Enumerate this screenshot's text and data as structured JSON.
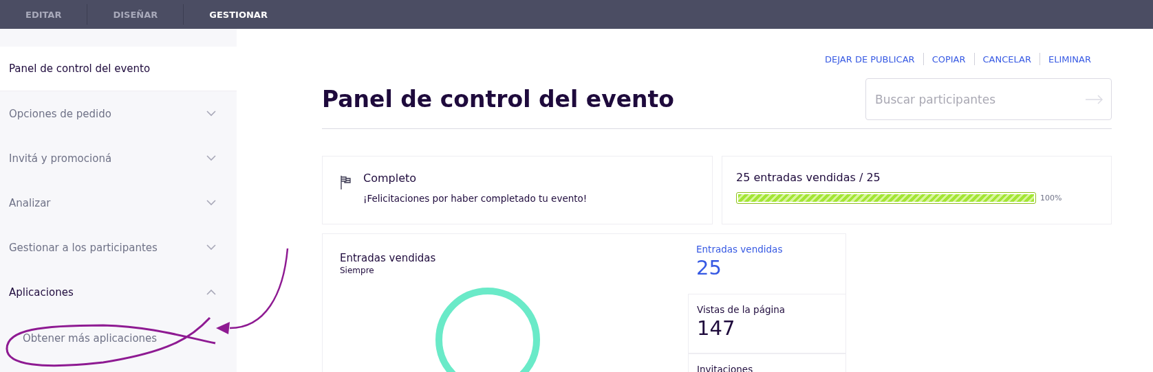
{
  "top_tabs": [
    {
      "label": "EDITAR",
      "selected": false
    },
    {
      "label": "DISEÑAR",
      "selected": false
    },
    {
      "label": "GESTIONAR",
      "selected": true
    }
  ],
  "sidebar": {
    "items": [
      {
        "label": "Panel de control del evento",
        "selected": true
      },
      {
        "label": "Opciones de pedido",
        "selected": false,
        "expanded": false
      },
      {
        "label": "Invitá y promocioná",
        "selected": false,
        "expanded": false
      },
      {
        "label": "Analizar",
        "selected": false,
        "expanded": false
      },
      {
        "label": "Gestionar a los participantes",
        "selected": false,
        "expanded": false
      },
      {
        "label": "Aplicaciones",
        "selected": false,
        "expanded": true,
        "children": [
          {
            "label": "Obtener más aplicaciones"
          }
        ]
      }
    ]
  },
  "actions": [
    "DEJAR DE PUBLICAR",
    "COPIAR",
    "CANCELAR",
    "ELIMINAR"
  ],
  "title": "Panel de control del evento",
  "search": {
    "placeholder": "Buscar participantes"
  },
  "status_card": {
    "title": "Completo",
    "message": "¡Felicitaciones por haber completado tu evento!"
  },
  "sales_card": {
    "title": "25 entradas vendidas / 25",
    "level": 1,
    "reading": "100%"
  },
  "chart_card": {
    "title": "Entradas vendidas",
    "subtitle": "Siempre"
  },
  "stats": [
    {
      "label": "Entradas vendidas",
      "value": "25",
      "selected": true
    },
    {
      "label": "Vistas de la página",
      "value": "147",
      "selected": false
    },
    {
      "label": "Invitaciones",
      "selected": false
    }
  ]
}
